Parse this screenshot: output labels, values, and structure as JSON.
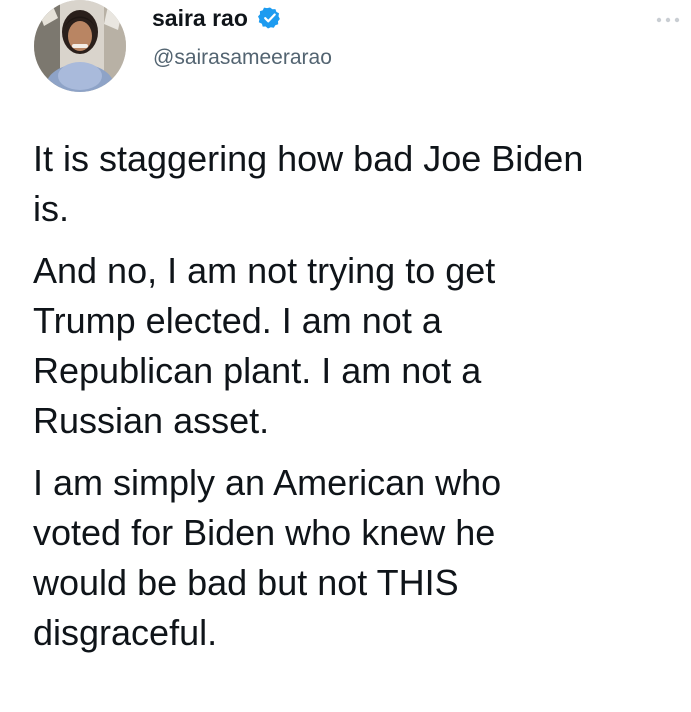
{
  "tweet": {
    "author": {
      "display_name": "saira rao",
      "handle": "@sairasameerarao",
      "verified": true,
      "verified_color": "#1d9bf0"
    },
    "more_icon": "more-horizontal-icon",
    "paragraphs": [
      "It is staggering how bad Joe Biden\nis.",
      "And no, I am not trying to get\nTrump elected. I am not a\nRepublican plant. I am not a\nRussian asset.",
      "I am simply an American who\nvoted for Biden who knew he\nwould be bad but not THIS\ndisgraceful."
    ]
  }
}
